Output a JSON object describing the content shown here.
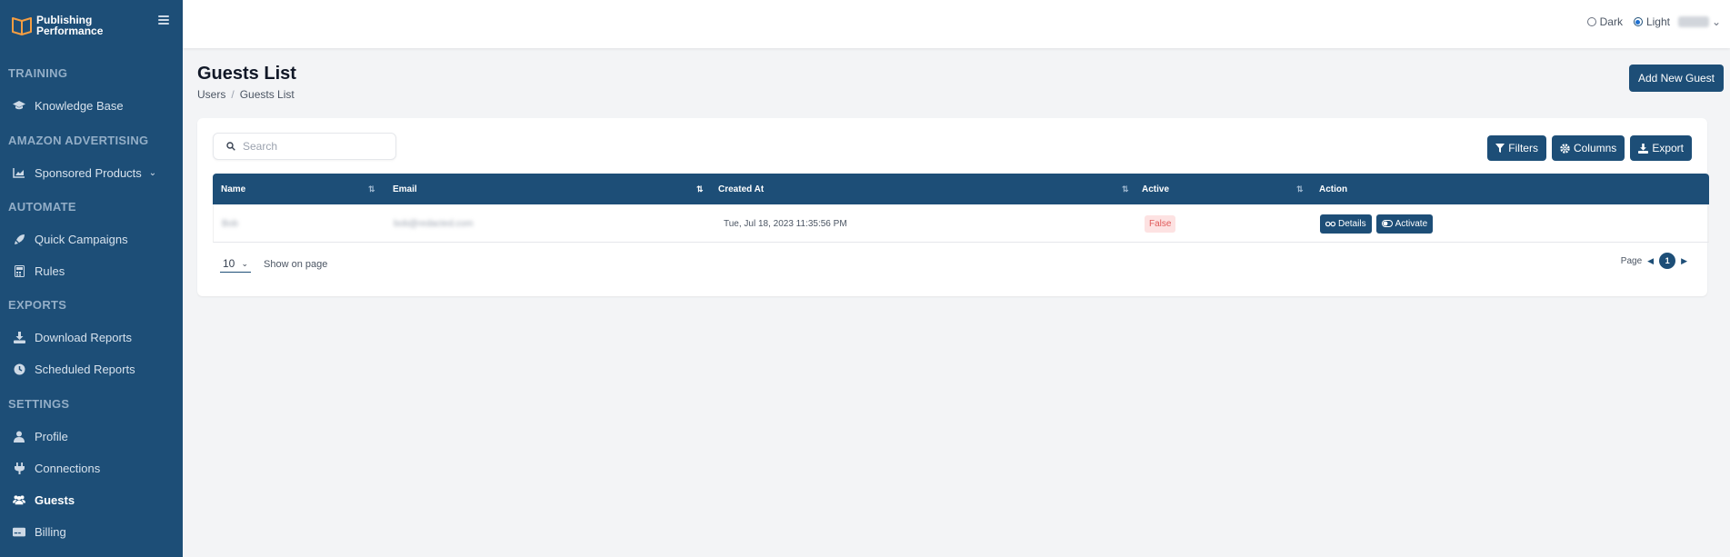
{
  "app": {
    "brand_line1": "Publishing",
    "brand_line2": "Performance",
    "brand_color": "#1d4e77"
  },
  "sidebar": {
    "sections": [
      {
        "title": "TRAINING",
        "items": [
          {
            "label": "Knowledge Base",
            "icon": "graduation-cap-icon"
          }
        ]
      },
      {
        "title": "AMAZON ADVERTISING",
        "items": [
          {
            "label": "Sponsored Products",
            "icon": "chart-area-icon"
          }
        ]
      },
      {
        "title": "AUTOMATE",
        "items": [
          {
            "label": "Quick Campaigns",
            "icon": "rocket-icon"
          },
          {
            "label": "Rules",
            "icon": "calculator-icon"
          }
        ]
      },
      {
        "title": "EXPORTS",
        "items": [
          {
            "label": "Download Reports",
            "icon": "download-icon"
          },
          {
            "label": "Scheduled Reports",
            "icon": "clock-icon"
          }
        ]
      },
      {
        "title": "SETTINGS",
        "items": [
          {
            "label": "Profile",
            "icon": "user-icon"
          },
          {
            "label": "Connections",
            "icon": "plug-icon"
          },
          {
            "label": "Guests",
            "icon": "users-icon"
          },
          {
            "label": "Billing",
            "icon": "credit-card-icon"
          }
        ]
      }
    ],
    "active_item": "Guests"
  },
  "topbar": {
    "theme_dark_label": "Dark",
    "theme_light_label": "Light",
    "theme_selected": "Light"
  },
  "header": {
    "title": "Guests List",
    "breadcrumb": [
      "Users",
      "Guests List"
    ],
    "add_button_label": "Add New Guest"
  },
  "toolbar": {
    "search_placeholder": "Search",
    "filters_label": "Filters",
    "columns_label": "Columns",
    "export_label": "Export"
  },
  "table": {
    "columns": [
      "Name",
      "Email",
      "Created At",
      "Active",
      "Action"
    ],
    "rows": [
      {
        "name": "Bob",
        "email": "bob@redacted.com",
        "created_at": "Tue, Jul 18, 2023 11:35:56 PM",
        "active": "False",
        "actions": [
          "Details",
          "Activate"
        ]
      }
    ]
  },
  "pagination": {
    "per_page": "10",
    "per_page_label": "Show on page",
    "page_label": "Page",
    "current_page": "1"
  }
}
